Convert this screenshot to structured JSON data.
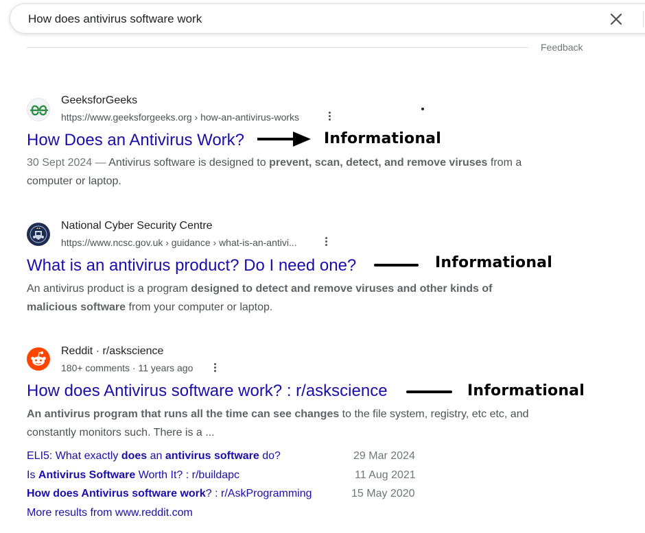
{
  "search": {
    "query": "How does antivirus software work"
  },
  "feedback_label": "Feedback",
  "results": [
    {
      "site_name": "GeeksforGeeks",
      "url": "https://www.geeksforgeeks.org › how-an-antivirus-works",
      "title": "How Does an Antivirus Work?",
      "snippet_date": "30 Sept 2024 —",
      "snippet_a": " Antivirus software is designed to ",
      "snippet_b": "prevent, scan, detect, and remove viruses",
      "snippet_c": " from a",
      "snippet_d": "computer or laptop.",
      "annotation": "Informational",
      "icon": "geeksforgeeks-logo-icon"
    },
    {
      "site_name": "National Cyber Security Centre",
      "url": "https://www.ncsc.gov.uk › guidance › what-is-an-antivi...",
      "title": "What is an antivirus product? Do I need one?",
      "snippet_a": "An antivirus product is a program ",
      "snippet_b": "designed to detect and remove viruses and other kinds of",
      "snippet_b2": "malicious software",
      "snippet_c": " from your computer or laptop.",
      "annotation": "Informational",
      "icon": "ncsc-crest-icon"
    },
    {
      "site_name": "Reddit · r/askscience",
      "meta_comments": "180+ comments",
      "meta_sep": " · ",
      "meta_age": "11 years ago",
      "title": "How does Antivirus software work? : r/askscience",
      "snippet_b": "An antivirus program that runs all the time can see changes",
      "snippet_c": " to the file system, registry, etc etc, and",
      "snippet_d": "constantly monitors such. There is a ...",
      "annotation": "Informational",
      "icon": "reddit-logo-icon",
      "sublinks": [
        {
          "pre": "ELI5: What exactly ",
          "b1": "does",
          "mid": " an ",
          "b2": "antivirus software",
          "post": " do?",
          "date": "29 Mar 2024"
        },
        {
          "pre": "Is ",
          "b1": "Antivirus Software",
          "mid": " Worth It? : r/buildapc",
          "b2": "",
          "post": "",
          "date": "11 Aug 2021"
        },
        {
          "pre": "",
          "b1": "How does Antivirus software work",
          "mid": "? : r/AskProgramming",
          "b2": "",
          "post": "",
          "date": "15 May 2020"
        }
      ],
      "more_results": "More results from www.reddit.com"
    }
  ],
  "colors": {
    "link": "#1a0dab",
    "text": "#202124",
    "url": "#4d5156",
    "snippet": "#4d5156",
    "reddit": "#ff4500",
    "gfg": "#2f8d46",
    "ncsc": "#1d2b4f"
  }
}
